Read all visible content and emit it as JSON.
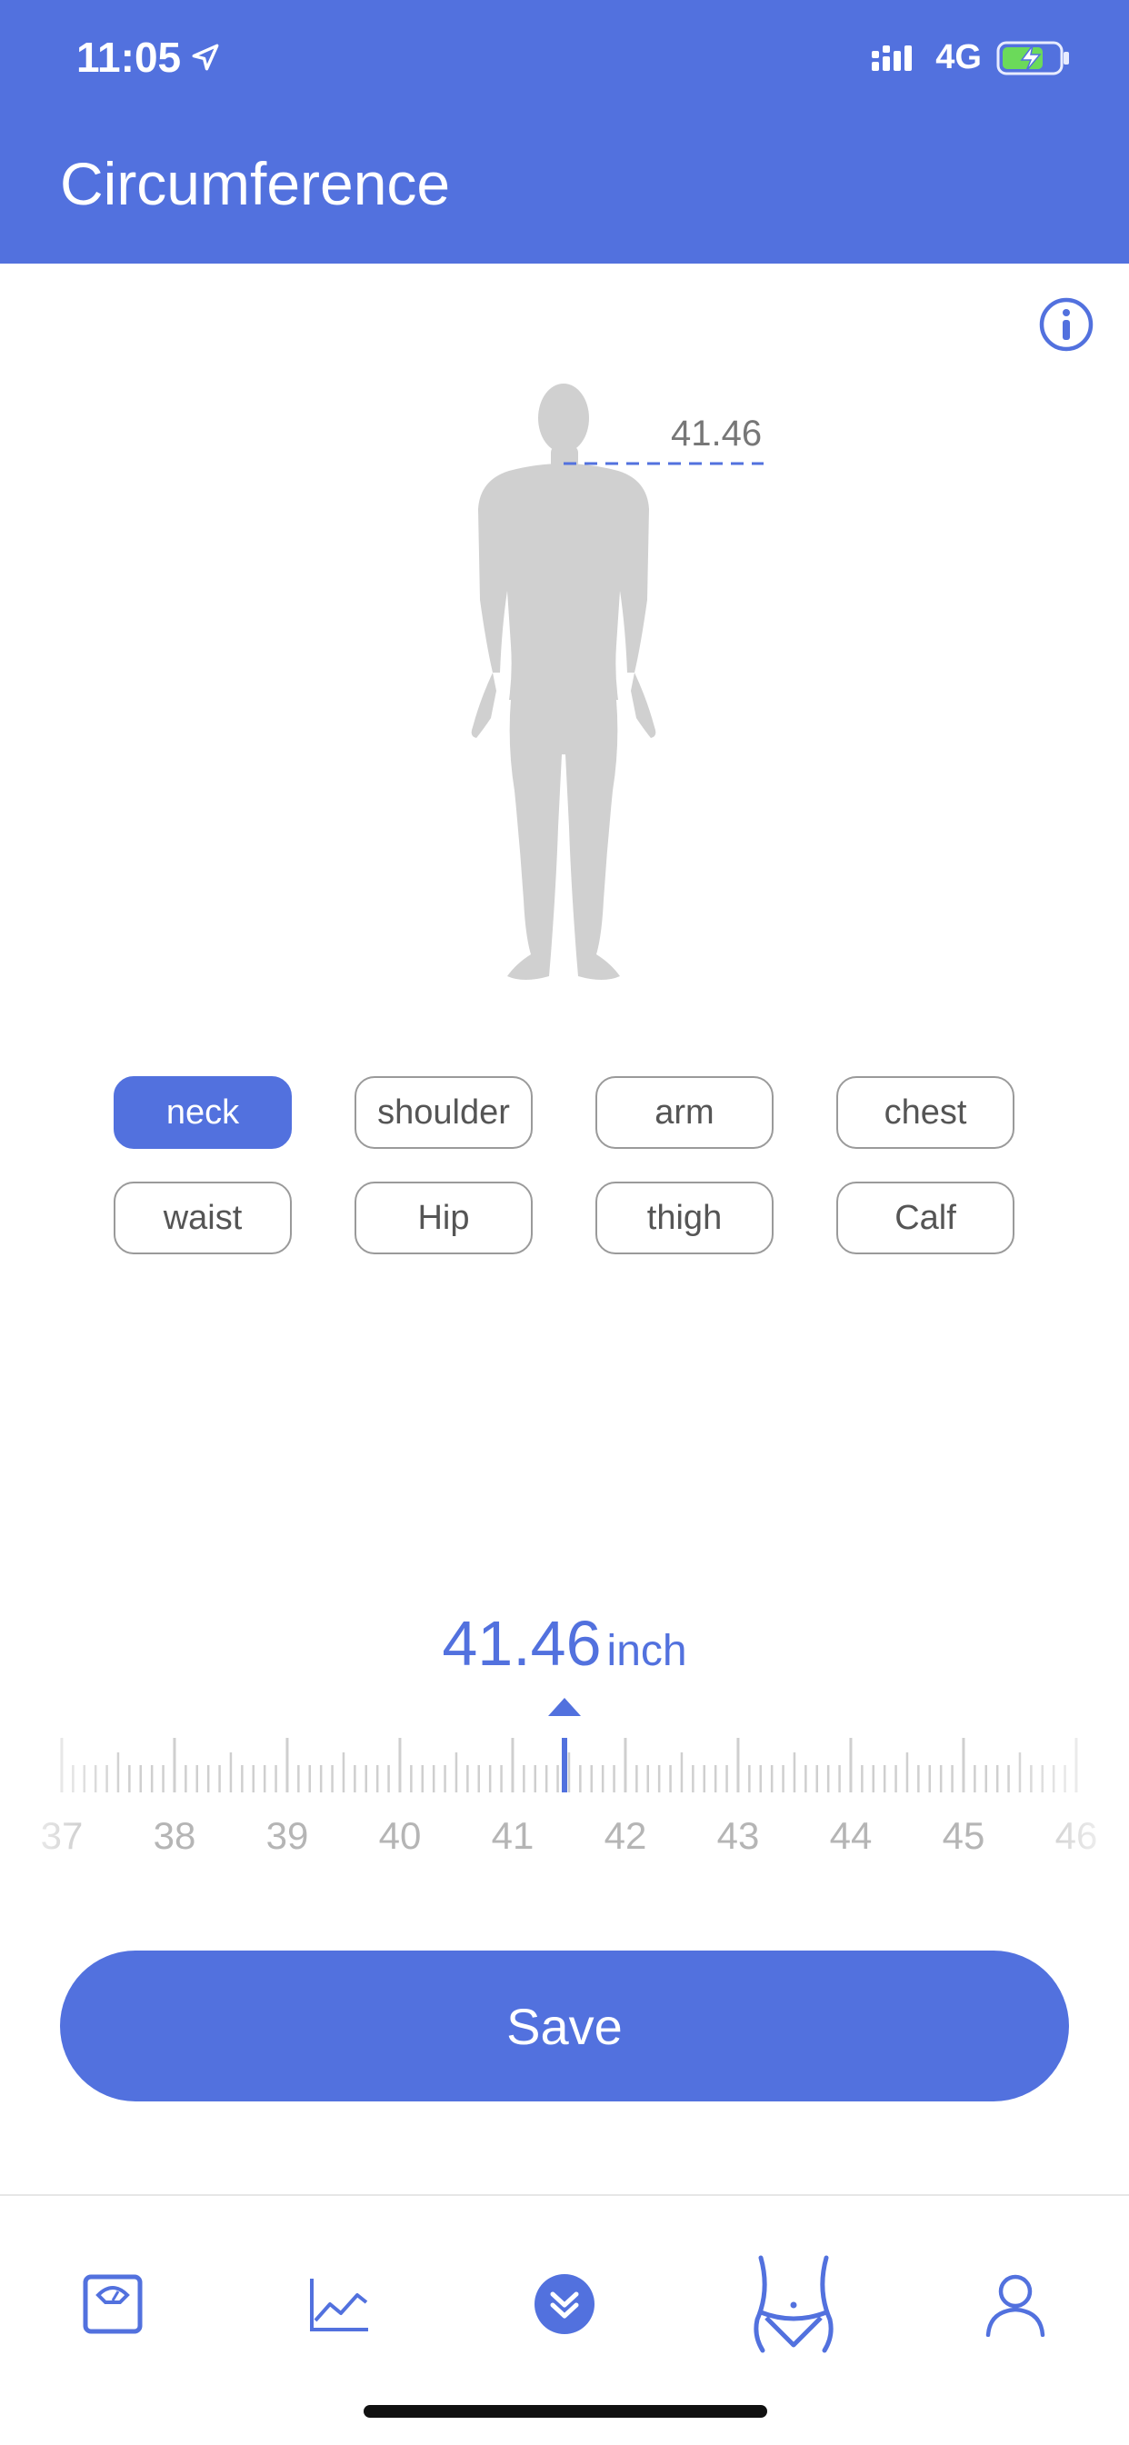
{
  "status_bar": {
    "time": "11:05",
    "network": "4G"
  },
  "header": {
    "title": "Circumference"
  },
  "figure": {
    "value": "41.46"
  },
  "parts": [
    {
      "label": "neck",
      "active": true
    },
    {
      "label": "shoulder",
      "active": false
    },
    {
      "label": "arm",
      "active": false
    },
    {
      "label": "chest",
      "active": false
    },
    {
      "label": "waist",
      "active": false
    },
    {
      "label": "Hip",
      "active": false
    },
    {
      "label": "thigh",
      "active": false
    },
    {
      "label": "Calf",
      "active": false
    }
  ],
  "reading": {
    "value": "41.46",
    "unit": "inch"
  },
  "ruler": {
    "min": 37,
    "max": 46,
    "selected": 41.46,
    "labels": [
      "37",
      "38",
      "39",
      "40",
      "41",
      "42",
      "43",
      "44",
      "45",
      "46"
    ]
  },
  "save_label": "Save",
  "tabs": [
    {
      "icon": "scale-icon"
    },
    {
      "icon": "chart-line-icon"
    },
    {
      "icon": "expand-down-icon"
    },
    {
      "icon": "body-waist-icon",
      "selected": true
    },
    {
      "icon": "profile-icon"
    }
  ],
  "colors": {
    "accent": "#5271DE",
    "figure": "#D0D0D0"
  }
}
